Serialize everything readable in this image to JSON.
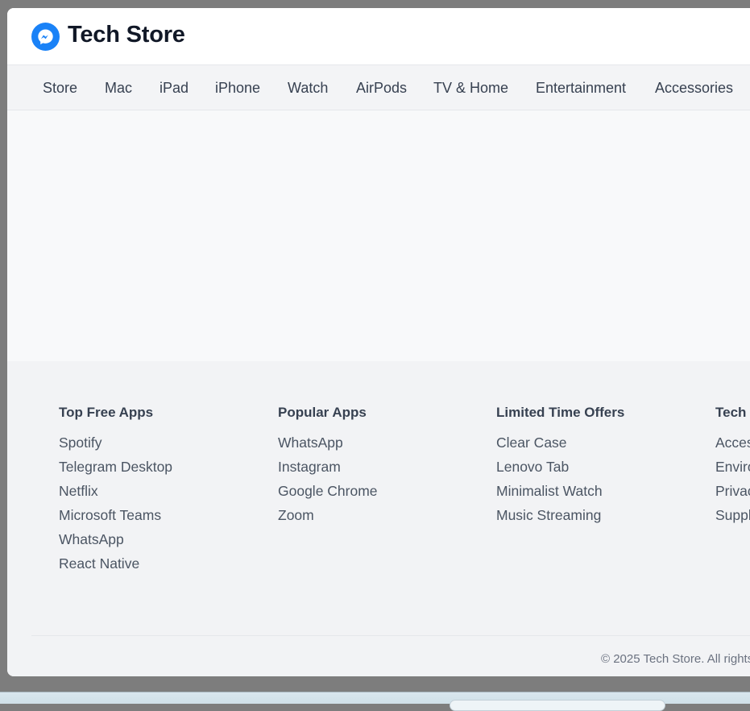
{
  "header": {
    "title": "Tech Store",
    "logo_icon": "messenger-icon",
    "logo_color": "#1a82f7"
  },
  "nav": {
    "items": [
      {
        "label": "Store"
      },
      {
        "label": "Mac"
      },
      {
        "label": "iPad"
      },
      {
        "label": "iPhone"
      },
      {
        "label": "Watch"
      },
      {
        "label": "AirPods"
      },
      {
        "label": "TV & Home"
      },
      {
        "label": "Entertainment"
      },
      {
        "label": "Accessories"
      }
    ]
  },
  "footer": {
    "columns": [
      {
        "heading": "Top Free Apps",
        "links": [
          "Spotify",
          "Telegram Desktop",
          "Netflix",
          "Microsoft Teams",
          "WhatsApp",
          "React Native"
        ]
      },
      {
        "heading": "Popular Apps",
        "links": [
          "WhatsApp",
          "Instagram",
          "Google Chrome",
          "Zoom"
        ]
      },
      {
        "heading": "Limited Time Offers",
        "links": [
          "Clear Case",
          "Lenovo Tab",
          "Minimalist Watch",
          "Music Streaming"
        ]
      },
      {
        "heading": "Tech V",
        "links": [
          "Acces",
          "Enviro",
          "Privac",
          "Suppl"
        ]
      }
    ],
    "copyright": "© 2025 Tech Store. All rights"
  }
}
